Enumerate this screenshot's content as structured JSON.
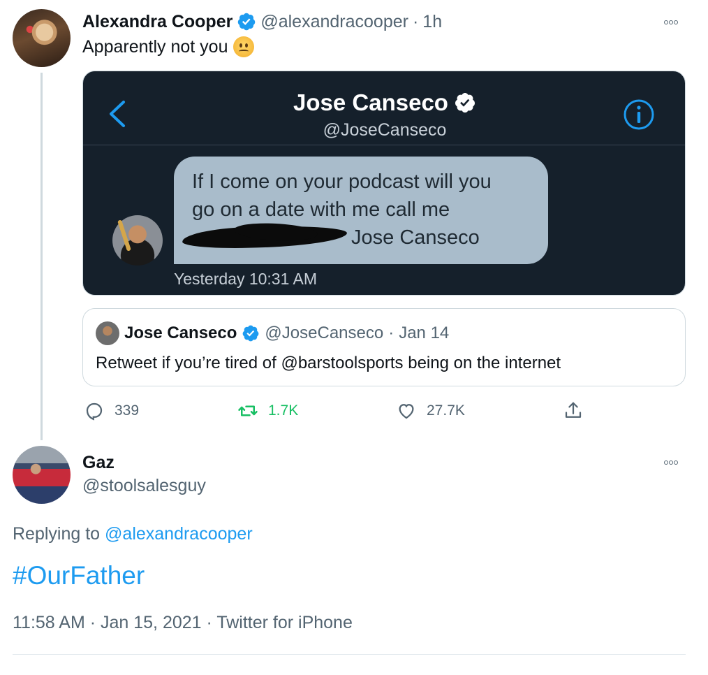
{
  "tweet": {
    "author_name": "Alexandra Cooper",
    "author_handle": "@alexandracooper",
    "time_ago": "1h",
    "separator": "·",
    "text": "Apparently not you",
    "emoji": "woozy-face",
    "dm_screenshot": {
      "contact_name": "Jose Canseco",
      "contact_handle": "@JoseCanseco",
      "message_line1": "If I come on your podcast will you",
      "message_line2": "go on a date with me call me",
      "message_line3_visible_tail": "Jose Canseco",
      "timestamp": "Yesterday 10:31 AM"
    },
    "quoted": {
      "author_name": "Jose Canseco",
      "author_handle": "@JoseCanseco",
      "date": "Jan 14",
      "separator": "·",
      "text": "Retweet if you’re tired of @barstoolsports being on the internet"
    },
    "actions": {
      "replies": "339",
      "retweets": "1.7K",
      "likes": "27.7K"
    }
  },
  "reply": {
    "author_name": "Gaz",
    "author_handle": "@stoolsalesguy",
    "replying_prefix": "Replying to",
    "replying_to": "@alexandracooper",
    "text": "#OurFather",
    "meta": "11:58 AM · Jan 15, 2021 · Twitter for iPhone"
  },
  "colors": {
    "link_blue": "#1d9bf0",
    "retweet_green": "#17bf63",
    "secondary_text": "#536471",
    "dm_background": "#15202b",
    "dm_bubble": "#a9bccb"
  }
}
